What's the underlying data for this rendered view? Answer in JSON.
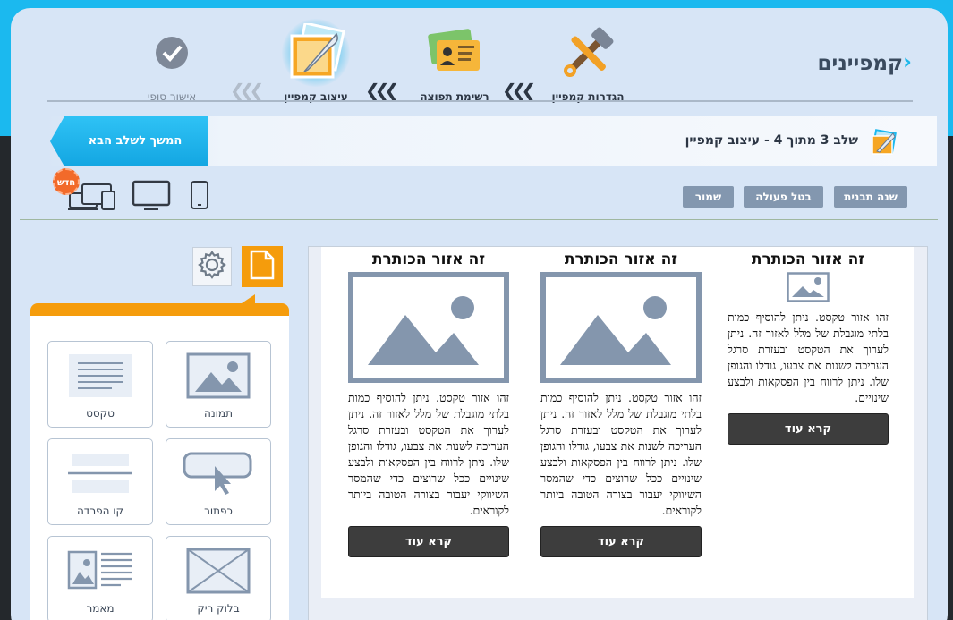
{
  "header": {
    "title": "קמפיינים",
    "steps": [
      {
        "label": "הגדרות קמפיין",
        "icon": "tools-icon",
        "state": "done"
      },
      {
        "label": "רשימת תפוצה",
        "icon": "contact-cards-icon",
        "state": "done"
      },
      {
        "label": "עיצוב קמפיין",
        "icon": "design-feather-icon",
        "state": "current"
      },
      {
        "label": "אישור סופי",
        "icon": "checkmark-icon",
        "state": "pending"
      }
    ],
    "step_arrows": "❮❮❮"
  },
  "step_bar": {
    "text": "שלב 3 מתוך 4 - עיצוב קמפיין",
    "next_button": "המשך לשלב הבא"
  },
  "toolbar": {
    "change_template": "שנה תבנית",
    "cancel_action": "בטל פעולה",
    "save": "שמור",
    "new_badge": "חדש",
    "devices": [
      "mobile-icon",
      "desktop-icon",
      "multi-device-icon"
    ]
  },
  "panel": {
    "tabs": [
      "page-icon",
      "gear-icon"
    ],
    "blocks": [
      {
        "label": "תמונה",
        "icon": "image-block-icon"
      },
      {
        "label": "טקסט",
        "icon": "text-block-icon"
      },
      {
        "label": "כפתור",
        "icon": "button-block-icon"
      },
      {
        "label": "קו הפרדה",
        "icon": "divider-block-icon"
      },
      {
        "label": "בלוק ריק",
        "icon": "empty-block-icon"
      },
      {
        "label": "מאמר",
        "icon": "article-block-icon"
      }
    ]
  },
  "canvas": {
    "columns": [
      {
        "title": "זה אזור הכותרת",
        "text": "זהו אזור טקסט. ניתן להוסיף כמות בלתי מוגבלת של מלל לאזור זה. ניתן לערוך את הטקסט ובעזרת סרגל העריכה לשנות את צבעו, גודלו והגופן שלו. ניתן לרווח בין הפסקאות ולבצע שינויים ככל שרוצים כדי שהמסר השיווקי יעבור בצורה הטובה ביותר לקוראים.",
        "button": "קרא עוד"
      },
      {
        "title": "זה אזור הכותרת",
        "text": "זהו אזור טקסט. ניתן להוסיף כמות בלתי מוגבלת של מלל לאזור זה. ניתן לערוך את הטקסט ובעזרת סרגל העריכה לשנות את צבעו, גודלו והגופן שלו. ניתן לרווח בין הפסקאות ולבצע שינויים ככל שרוצים כדי שהמסר השיווקי יעבור בצורה הטובה ביותר לקוראים.",
        "button": "קרא עוד"
      },
      {
        "title": "זה אזור הכותרת",
        "text": "זהו אזור טקסט. ניתן להוסיף כמות בלתי מוגבלת של מלל לאזור זה. ניתן לערוך את הטקסט ובעזרת סרגל העריכה לשנות את צבעו, גודלו והגופן שלו. ניתן לרווח בין הפסקאות ולבצע שינויים.",
        "button": "קרא עוד"
      }
    ]
  },
  "colors": {
    "accent_blue": "#1bb9ef",
    "accent_orange": "#f59c0c",
    "frame_bg": "#d7e5f6",
    "toolbar_button": "#8397af",
    "read_more_button": "#3d3d3d"
  }
}
